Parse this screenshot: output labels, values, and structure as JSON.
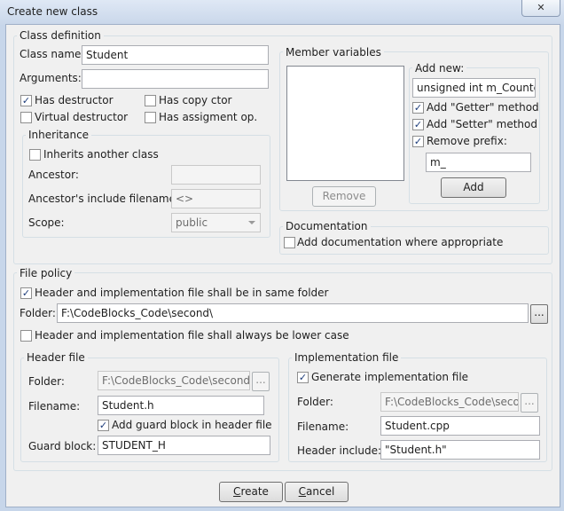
{
  "window": {
    "title": "Create new class",
    "close_symbol": "✕"
  },
  "class_definition": {
    "title": "Class definition",
    "class_name_label": "Class name:",
    "class_name_value": "Student",
    "arguments_label": "Arguments:",
    "arguments_value": "",
    "has_destructor_label": "Has destructor",
    "has_destructor_checked": true,
    "has_copy_ctor_label": "Has copy ctor",
    "has_copy_ctor_checked": false,
    "virtual_destructor_label": "Virtual destructor",
    "virtual_destructor_checked": false,
    "has_assignment_label": "Has assigment op.",
    "has_assignment_checked": false,
    "inheritance": {
      "title": "Inheritance",
      "inherits_label": "Inherits another class",
      "inherits_checked": false,
      "ancestor_label": "Ancestor:",
      "ancestor_value": "",
      "ancestor_include_label": "Ancestor's include filename:",
      "ancestor_include_value": "<>",
      "scope_label": "Scope:",
      "scope_value": "public"
    }
  },
  "member_variables": {
    "title": "Member variables",
    "add_new_label": "Add new:",
    "add_new_value": "unsigned int m_Counter",
    "add_getter_label": "Add \"Getter\" method",
    "add_getter_checked": true,
    "add_setter_label": "Add \"Setter\" method",
    "add_setter_checked": true,
    "remove_prefix_label": "Remove prefix:",
    "remove_prefix_checked": true,
    "prefix_value": "m_",
    "remove_button": "Remove",
    "add_button": "Add"
  },
  "documentation": {
    "title": "Documentation",
    "add_doc_label": "Add documentation where appropriate",
    "add_doc_checked": false
  },
  "file_policy": {
    "title": "File policy",
    "same_folder_label": "Header and implementation file shall be in same folder",
    "same_folder_checked": true,
    "folder_label": "Folder:",
    "folder_value": "F:\\CodeBlocks_Code\\second\\",
    "browse_label": "...",
    "lower_case_label": "Header and implementation file shall always be lower case",
    "lower_case_checked": false,
    "header_file": {
      "title": "Header file",
      "folder_label": "Folder:",
      "folder_value": "F:\\CodeBlocks_Code\\second\\in",
      "filename_label": "Filename:",
      "filename_value": "Student.h",
      "guard_label": "Add guard block in header file",
      "guard_checked": true,
      "guard_block_label": "Guard block:",
      "guard_block_value": "STUDENT_H"
    },
    "implementation_file": {
      "title": "Implementation file",
      "generate_label": "Generate implementation file",
      "generate_checked": true,
      "folder_label": "Folder:",
      "folder_value": "F:\\CodeBlocks_Code\\secon",
      "filename_label": "Filename:",
      "filename_value": "Student.cpp",
      "header_include_label": "Header include:",
      "header_include_value": "\"Student.h\""
    }
  },
  "buttons": {
    "create_first": "C",
    "create_rest": "reate",
    "cancel_first": "C",
    "cancel_rest": "ancel"
  }
}
